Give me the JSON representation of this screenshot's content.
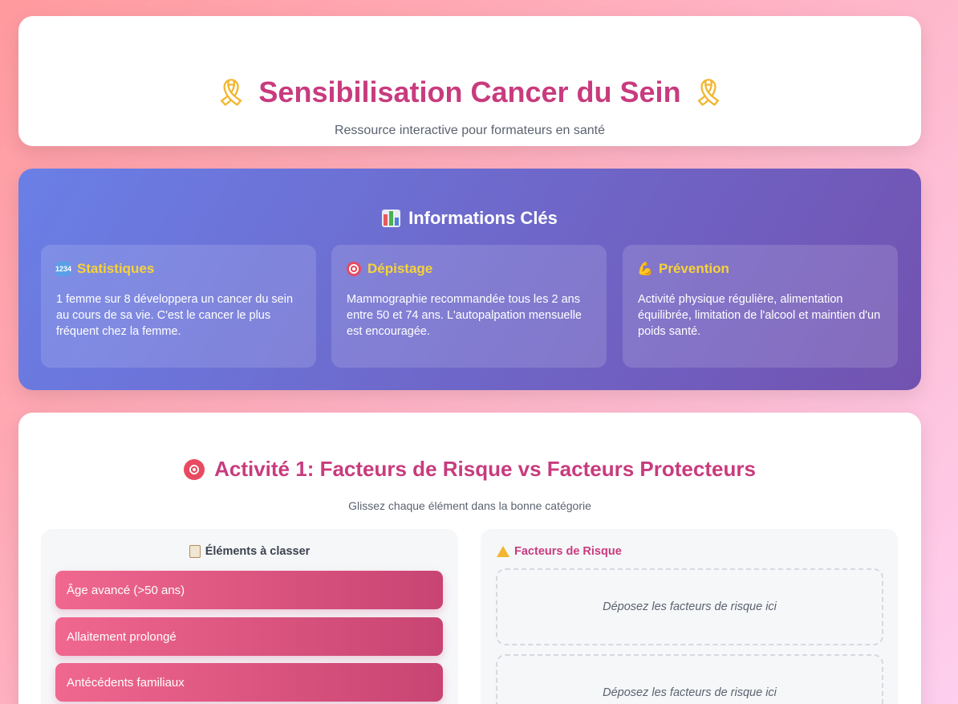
{
  "header": {
    "title": "Sensibilisation Cancer du Sein",
    "subtitle": "Ressource interactive pour formateurs en santé"
  },
  "info": {
    "title": "Informations Clés",
    "boxes": [
      {
        "icon": "numbers-icon",
        "title": "Statistiques",
        "text": "1 femme sur 8 développera un cancer du sein au cours de sa vie. C'est le cancer le plus fréquent chez la femme."
      },
      {
        "icon": "target-icon",
        "title": "Dépistage",
        "text": "Mammographie recommandée tous les 2 ans entre 50 et 74 ans. L'autopalpation mensuelle est encouragée."
      },
      {
        "icon": "muscle-icon",
        "title": "Prévention",
        "text": "Activité physique régulière, alimentation équilibrée, limitation de l'alcool et maintien d'un poids santé."
      }
    ]
  },
  "activity": {
    "title": "Activité 1: Facteurs de Risque vs Facteurs Protecteurs",
    "subtitle": "Glissez chaque élément dans la bonne catégorie",
    "left_title": "Éléments à classer",
    "items": [
      "Âge avancé (>50 ans)",
      "Allaitement prolongé",
      "Antécédents familiaux"
    ],
    "right_title": "Facteurs de Risque",
    "drop_placeholder_1": "Déposez les facteurs de risque ici",
    "drop_placeholder_2": "Déposez les facteurs de risque ici"
  },
  "colors": {
    "accent": "#c83b7e",
    "highlight": "#f7d23a",
    "item_start": "#f0678f",
    "item_end": "#c84472"
  }
}
